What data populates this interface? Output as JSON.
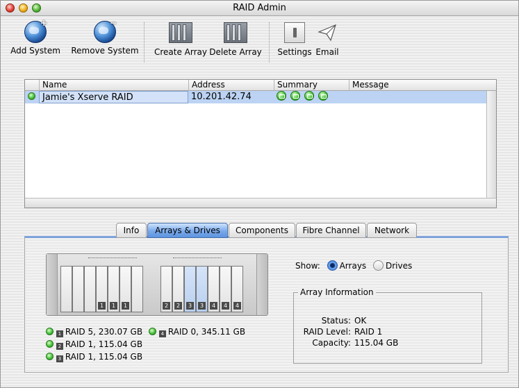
{
  "window": {
    "title": "RAID Admin"
  },
  "toolbar": {
    "add_system": "Add System",
    "remove_system": "Remove System",
    "create_array": "Create Array",
    "delete_array": "Delete Array",
    "settings": "Settings",
    "email": "Email"
  },
  "table": {
    "columns": [
      "Name",
      "Address",
      "Summary",
      "Message"
    ],
    "rows": [
      {
        "name": "Jamie's Xserve RAID",
        "address": "10.201.42.74",
        "summary_icons": [
          "storage-ok-icon",
          "drive-ok-icon",
          "array-ok-icon",
          "fibre-ok-icon"
        ],
        "message": ""
      }
    ]
  },
  "tabs": [
    "Info",
    "Arrays & Drives",
    "Components",
    "Fibre Channel",
    "Network"
  ],
  "active_tab": "Arrays & Drives",
  "drive_bays": {
    "left": [
      "",
      "",
      "",
      "1",
      "1",
      "1",
      ""
    ],
    "right": [
      "2",
      "2",
      "3",
      "3",
      "4",
      "4",
      "4"
    ]
  },
  "legend": [
    {
      "num": "1",
      "text": "RAID 5, 230.07 GB"
    },
    {
      "num": "4",
      "text": "RAID 0, 345.11 GB"
    },
    {
      "num": "2",
      "text": "RAID 1, 115.04 GB"
    },
    {
      "num": "3",
      "text": "RAID 1, 115.04 GB"
    }
  ],
  "show": {
    "label": "Show:",
    "arrays": "Arrays",
    "drives": "Drives",
    "selected": "Arrays"
  },
  "array_info": {
    "title": "Array Information",
    "status_label": "Status:",
    "status_value": "OK",
    "raid_level_label": "RAID Level:",
    "raid_level_value": "RAID 1",
    "capacity_label": "Capacity:",
    "capacity_value": "115.04 GB"
  },
  "colors": {
    "selection": "#bcd3f3",
    "tab_active": "#79a9ea",
    "status_green": "#44c13a"
  }
}
